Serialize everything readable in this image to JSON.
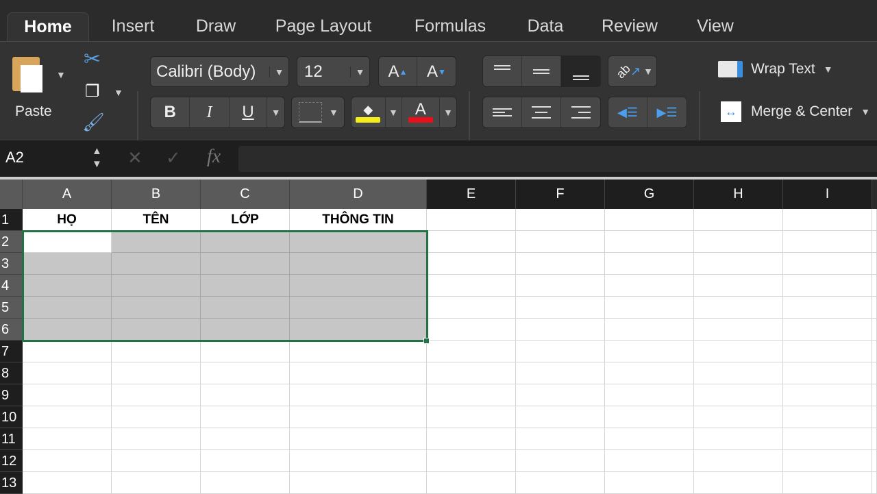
{
  "tabs": [
    {
      "label": "Home",
      "active": true
    },
    {
      "label": "Insert"
    },
    {
      "label": "Draw"
    },
    {
      "label": "Page Layout"
    },
    {
      "label": "Formulas"
    },
    {
      "label": "Data"
    },
    {
      "label": "Review"
    },
    {
      "label": "View"
    }
  ],
  "ribbon": {
    "paste_label": "Paste",
    "font_name": "Calibri (Body)",
    "font_size": "12",
    "bold": "B",
    "italic": "I",
    "underline": "U",
    "font_color_letter": "A",
    "wrap_text": "Wrap Text",
    "merge_center": "Merge & Center",
    "fill_color": "#f5ee1a",
    "font_color": "#e8101a"
  },
  "formula_bar": {
    "name_box": "A2",
    "fx": "fx",
    "value": ""
  },
  "grid": {
    "columns": [
      "A",
      "B",
      "C",
      "D",
      "E",
      "F",
      "G",
      "H",
      "I"
    ],
    "rows": [
      "1",
      "2",
      "3",
      "4",
      "5",
      "6",
      "7",
      "8",
      "9",
      "10",
      "11",
      "12",
      "13"
    ],
    "row1": [
      "HỌ",
      "TÊN",
      "LỚP",
      "THÔNG TIN",
      "",
      "",
      "",
      "",
      ""
    ],
    "selection": "A2:D6",
    "active_cell": "A2",
    "selection_color": "#217346"
  }
}
